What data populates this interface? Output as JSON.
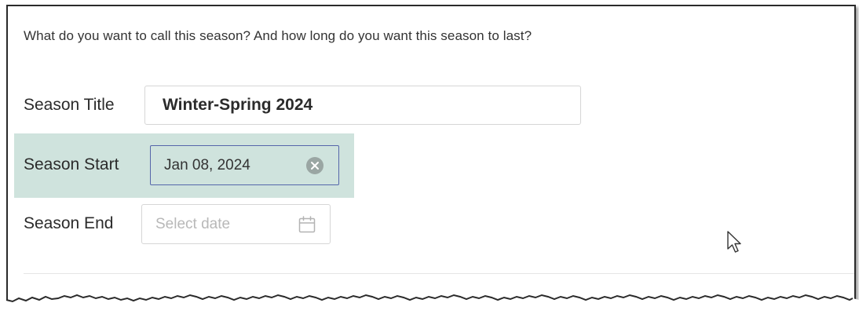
{
  "intro": {
    "text": "What do you want to call this season? And how long do you want this season to last?"
  },
  "fields": {
    "title": {
      "label": "Season Title",
      "value": "Winter-Spring 2024"
    },
    "start": {
      "label": "Season Start",
      "value": "Jan 08, 2024",
      "clear_icon": "clear-circle-icon"
    },
    "end": {
      "label": "Season End",
      "placeholder": "Select date",
      "calendar_icon": "calendar-icon"
    }
  },
  "colors": {
    "highlight": "#cfe3dd",
    "focus_border": "#5566aa",
    "placeholder": "#b8b8b8"
  }
}
